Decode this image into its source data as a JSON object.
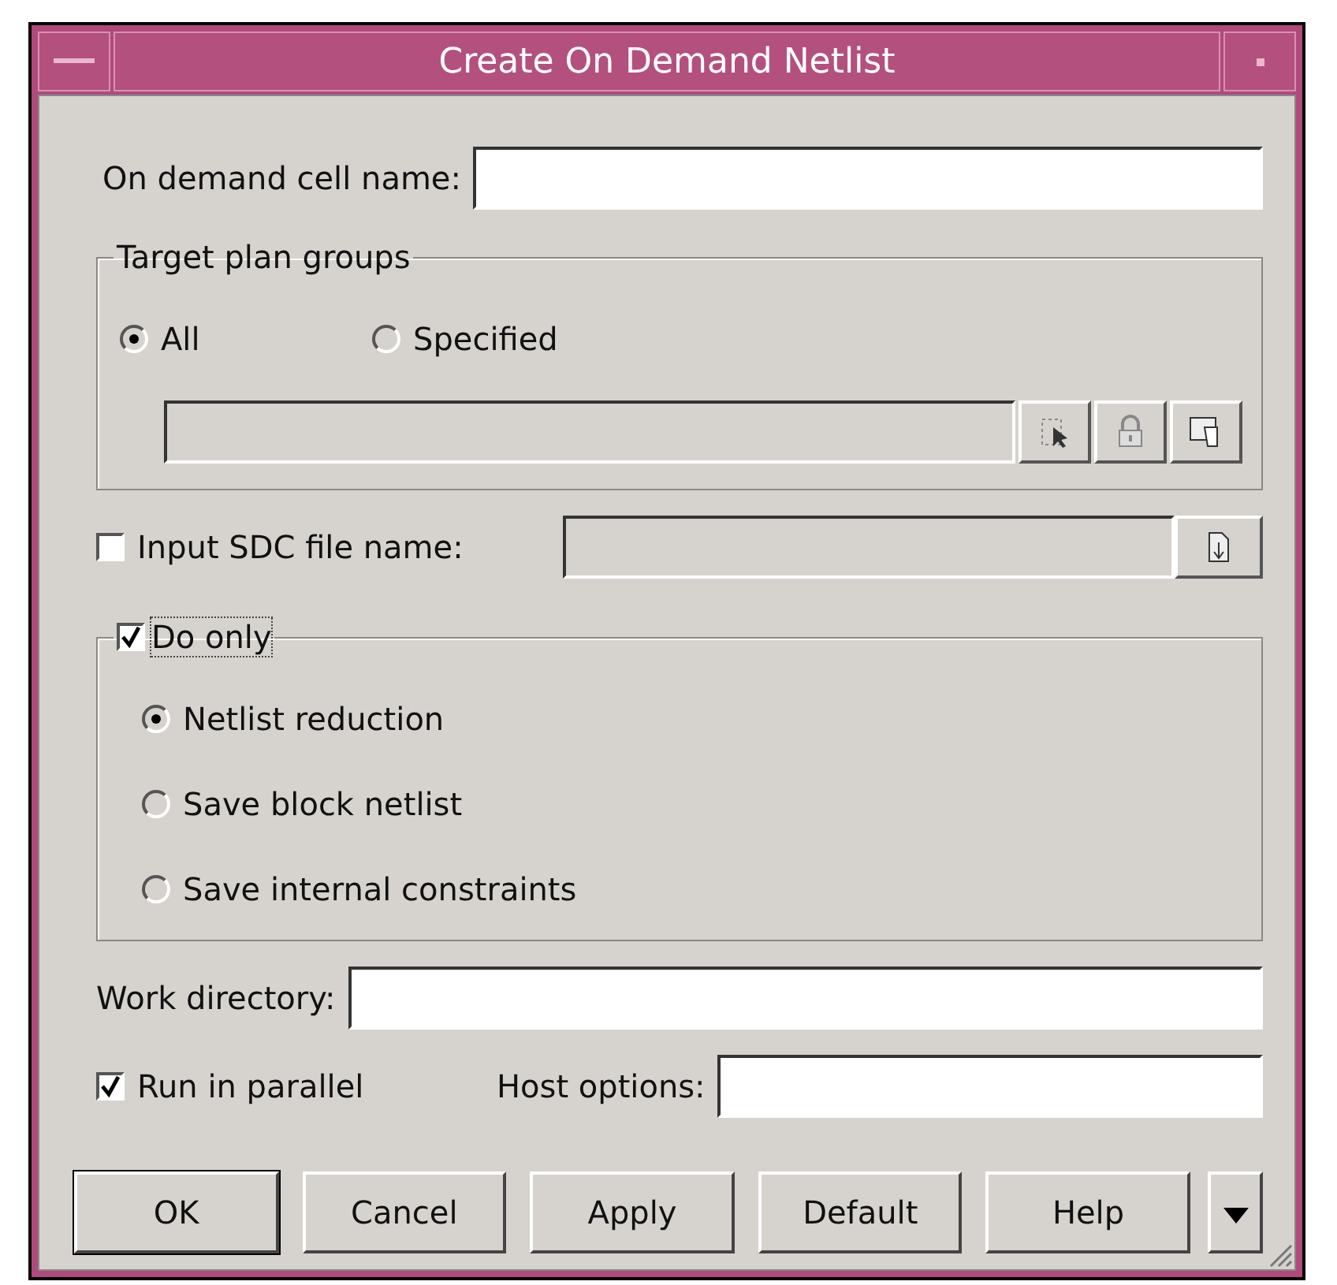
{
  "window": {
    "title": "Create On Demand Netlist"
  },
  "cell_name": {
    "label": "On demand cell name:"
  },
  "target_plan_groups": {
    "title": "Target plan groups",
    "options": [
      {
        "label": "All",
        "selected": true
      },
      {
        "label": "Specified",
        "selected": false
      }
    ],
    "field": {
      "disabled": true
    },
    "tools": [
      {
        "kind": "select"
      },
      {
        "kind": "lock"
      },
      {
        "kind": "browse"
      }
    ]
  },
  "sdc_file": {
    "label": "Input SDC file name:",
    "checked": false,
    "field": {
      "disabled": true
    }
  },
  "do_only": {
    "label": "Do only",
    "checked": true,
    "options": [
      {
        "label": "Netlist reduction",
        "selected": true
      },
      {
        "label": "Save block netlist",
        "selected": false
      },
      {
        "label": "Save internal constraints",
        "selected": false
      }
    ]
  },
  "work_directory": {
    "label": "Work directory:"
  },
  "run_in_parallel": {
    "label": "Run in parallel",
    "checked": true
  },
  "host_options": {
    "label": "Host options:"
  },
  "buttons": [
    {
      "label": "OK",
      "default": true
    },
    {
      "label": "Cancel",
      "default": false
    },
    {
      "label": "Apply",
      "default": false
    },
    {
      "label": "Default",
      "default": false
    },
    {
      "label": "Help",
      "default": false
    }
  ]
}
